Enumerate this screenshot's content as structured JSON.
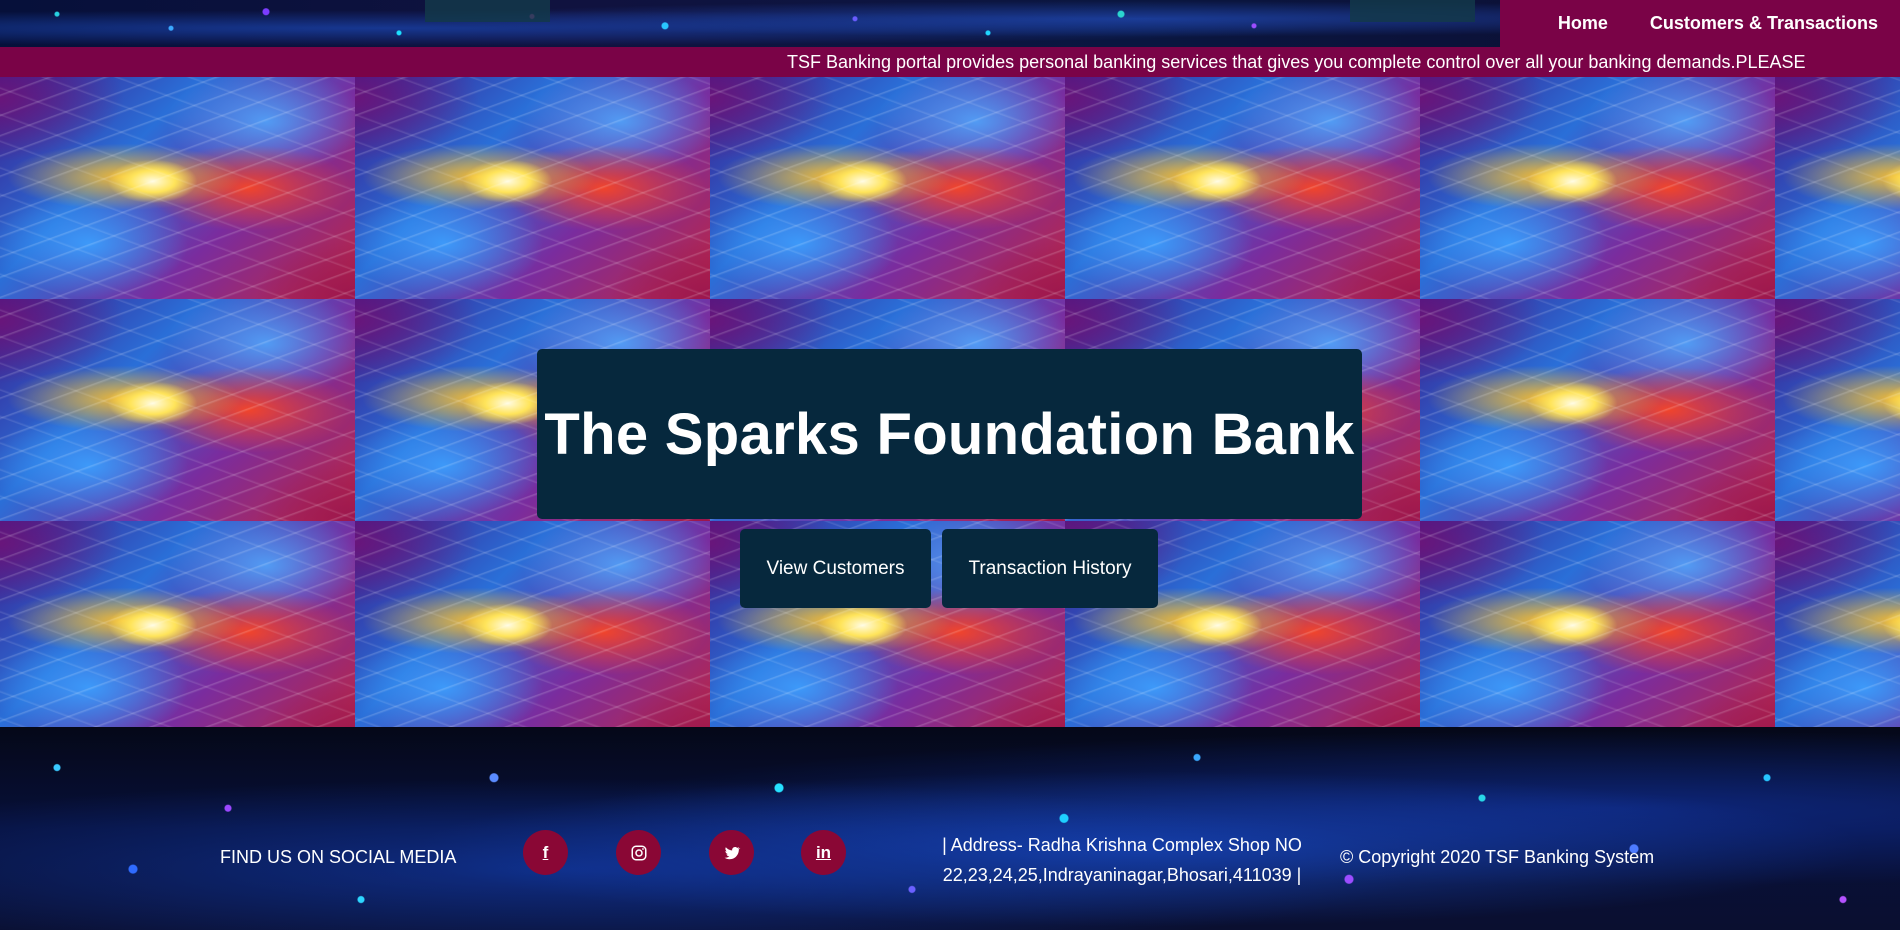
{
  "nav": {
    "home_label": "Home",
    "customers_label": "Customers & Transactions"
  },
  "marquee": {
    "text": "TSF Banking portal provides personal banking services that gives you complete control over all your banking demands.PLEASE"
  },
  "hero": {
    "title": "The Sparks Foundation Bank",
    "view_customers_label": "View Customers",
    "transaction_history_label": "Transaction History"
  },
  "footer": {
    "social_label": "FIND US ON SOCIAL MEDIA",
    "social_icons": {
      "facebook": "f",
      "instagram": "instagram-icon",
      "twitter": "twitter-icon",
      "linkedin": "in"
    },
    "address_line1": "| Address- Radha Krishna Complex Shop NO",
    "address_line2": "22,23,24,25,Indrayaninagar,Bhosari,411039 |",
    "copyright": "© Copyright 2020 TSF Banking System"
  },
  "colors": {
    "nav_bg": "#7a0347",
    "card_bg": "#06283d",
    "social_bg": "#8a0735"
  }
}
